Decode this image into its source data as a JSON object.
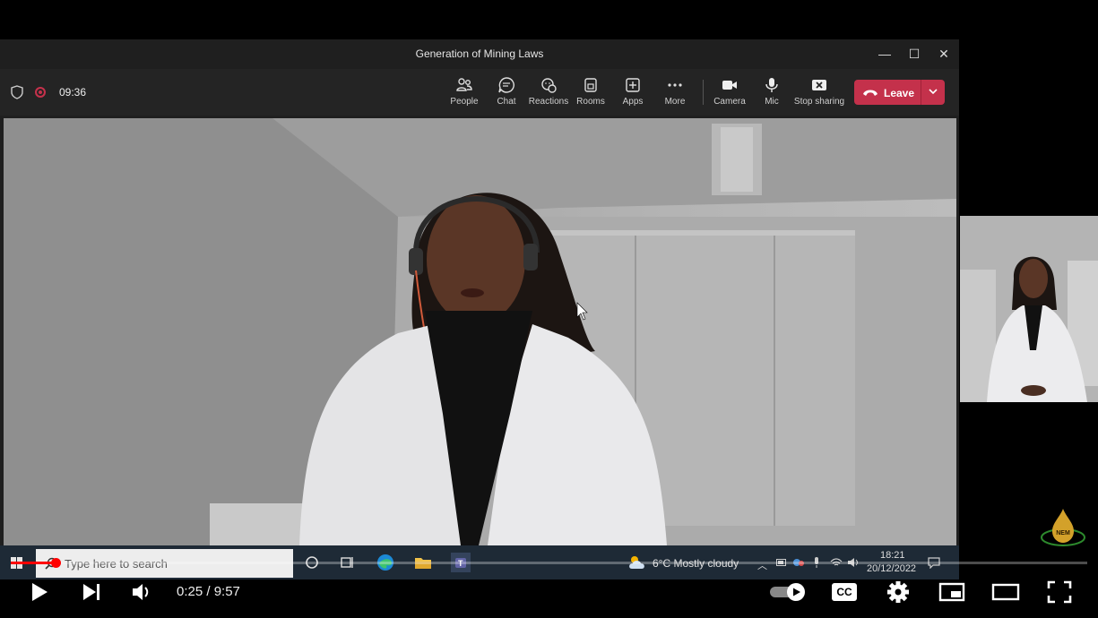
{
  "teams": {
    "window_title": "Generation of Mining Laws",
    "window_controls": {
      "minimize": "—",
      "maximize": "☐",
      "close": "✕"
    },
    "timer": "09:36",
    "toolbar": {
      "people": "People",
      "chat": "Chat",
      "reactions": "Reactions",
      "rooms": "Rooms",
      "apps": "Apps",
      "more": "More",
      "camera": "Camera",
      "mic": "Mic",
      "stop_sharing": "Stop sharing",
      "leave": "Leave"
    },
    "video_more": "···",
    "colors": {
      "leave": "#c4314b",
      "toolbar_bg": "#242424"
    }
  },
  "taskbar": {
    "search_placeholder": "Type here to search",
    "weather": "6°C  Mostly cloudy",
    "clock_time": "18:21",
    "clock_date": "20/12/2022",
    "icons": [
      "windows-start-icon",
      "cortana-icon",
      "task-view-icon",
      "edge-icon",
      "file-explorer-icon",
      "teams-icon"
    ]
  },
  "channel_logo_text": "NEM",
  "player": {
    "time": "0:25 / 9:57",
    "progress_fraction": 0.042,
    "cc_label": "CC",
    "colors": {
      "progress": "#ff0000"
    }
  }
}
